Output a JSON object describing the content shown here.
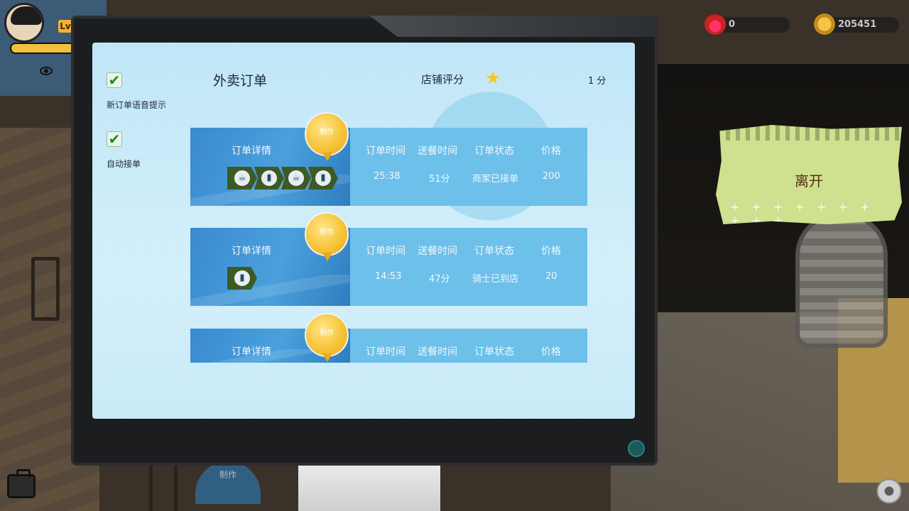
{
  "player": {
    "level_label": "Lv"
  },
  "currency": {
    "fire_count": "0",
    "coin_count": "205451"
  },
  "screen": {
    "auto_voice": {
      "label": "新订单语音提示",
      "checked": true
    },
    "auto_accept": {
      "label": "自动接单",
      "checked": true
    },
    "title": "外卖订单",
    "rating_label": "店铺评分",
    "rating_value": "1 分"
  },
  "order_columns": {
    "details": "订单详情",
    "order_time": "订单时间",
    "delivery_time": "送餐时间",
    "status": "订单状态",
    "price": "价格"
  },
  "make_label": "制作",
  "orders": [
    {
      "items": [
        "coffee-icon",
        "water-bottle-icon",
        "coffee-icon",
        "water-bottle-icon"
      ],
      "order_time": "25:38",
      "delivery_time": "51分",
      "status": "商家已接单",
      "price": "200"
    },
    {
      "items": [
        "water-bottle-icon"
      ],
      "order_time": "14:53",
      "delivery_time": "47分",
      "status": "骑士已到店",
      "price": "20"
    },
    {
      "items": [],
      "order_time": "",
      "delivery_time": "",
      "status": "",
      "price": ""
    }
  ],
  "leave_button": {
    "label": "离开"
  },
  "bottom_sign": {
    "label": "制作"
  }
}
